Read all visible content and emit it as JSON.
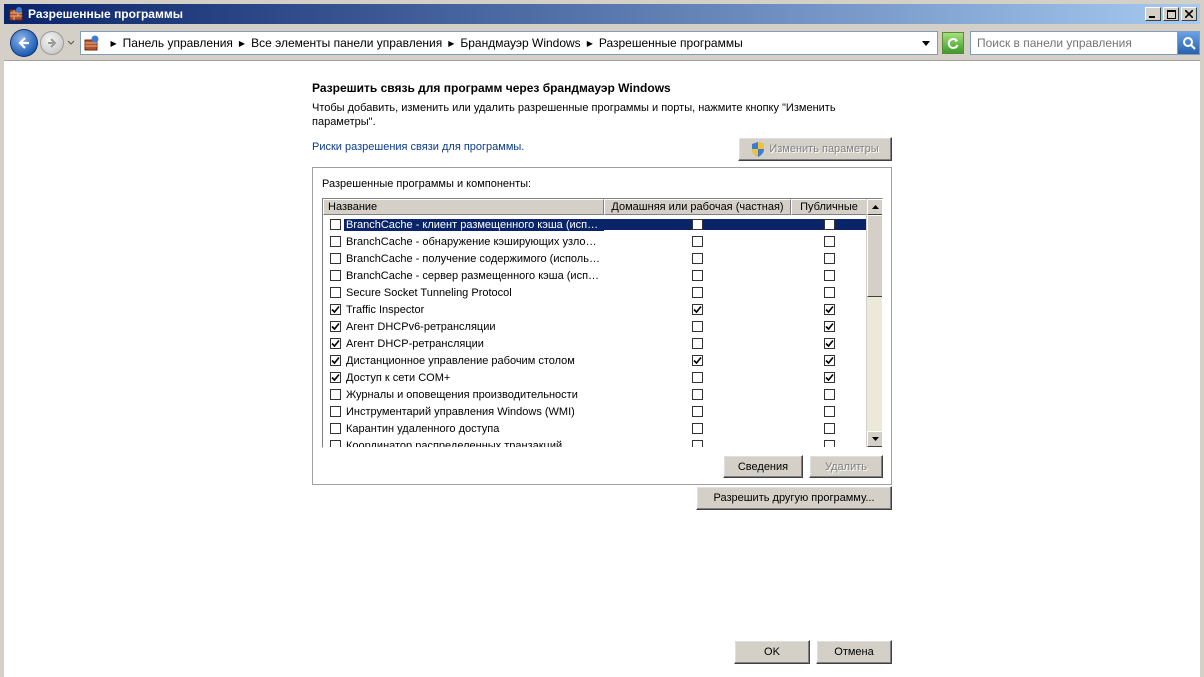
{
  "window": {
    "title": "Разрешенные программы"
  },
  "address": {
    "breadcrumbs": [
      "Панель управления",
      "Все элементы панели управления",
      "Брандмауэр Windows",
      "Разрешенные программы"
    ],
    "search_placeholder": "Поиск в панели управления"
  },
  "main": {
    "heading": "Разрешить связь для программ через брандмауэр Windows",
    "description": "Чтобы добавить, изменить или удалить разрешенные программы и порты, нажмите кнопку \"Изменить параметры\".",
    "risk_link": "Риски разрешения связи для программы.",
    "change_settings_label": "Изменить параметры",
    "group_label": "Разрешенные программы и компоненты:",
    "columns": {
      "name": "Название",
      "home": "Домашняя или рабочая (частная)",
      "public": "Публичные"
    },
    "programs": [
      {
        "name": "BranchCache - клиент размещенного кэша (испо...",
        "enabled": false,
        "home": false,
        "public": false,
        "selected": true
      },
      {
        "name": "BranchCache - обнаружение кэширующих узлов ...",
        "enabled": false,
        "home": false,
        "public": false
      },
      {
        "name": "BranchCache - получение содержимого (использ...",
        "enabled": false,
        "home": false,
        "public": false
      },
      {
        "name": "BranchCache - сервер размещенного кэша (испо...",
        "enabled": false,
        "home": false,
        "public": false
      },
      {
        "name": "Secure Socket Tunneling Protocol",
        "enabled": false,
        "home": false,
        "public": false
      },
      {
        "name": "Traffic Inspector",
        "enabled": true,
        "home": true,
        "public": true
      },
      {
        "name": "Агент DHCPv6-ретрансляции",
        "enabled": true,
        "home": false,
        "public": true
      },
      {
        "name": "Агент DHCP-ретрансляции",
        "enabled": true,
        "home": false,
        "public": true
      },
      {
        "name": "Дистанционное управление рабочим столом",
        "enabled": true,
        "home": true,
        "public": true
      },
      {
        "name": "Доступ к сети COM+",
        "enabled": true,
        "home": false,
        "public": true
      },
      {
        "name": "Журналы и оповещения производительности",
        "enabled": false,
        "home": false,
        "public": false
      },
      {
        "name": "Инструментарий управления Windows (WMI)",
        "enabled": false,
        "home": false,
        "public": false
      },
      {
        "name": "Карантин удаленного доступа",
        "enabled": false,
        "home": false,
        "public": false
      },
      {
        "name": "Координатор распределенных транзакций",
        "enabled": false,
        "home": false,
        "public": false
      }
    ],
    "details_label": "Сведения",
    "delete_label": "Удалить",
    "allow_other_label": "Разрешить другую программу...",
    "ok_label": "OK",
    "cancel_label": "Отмена"
  }
}
